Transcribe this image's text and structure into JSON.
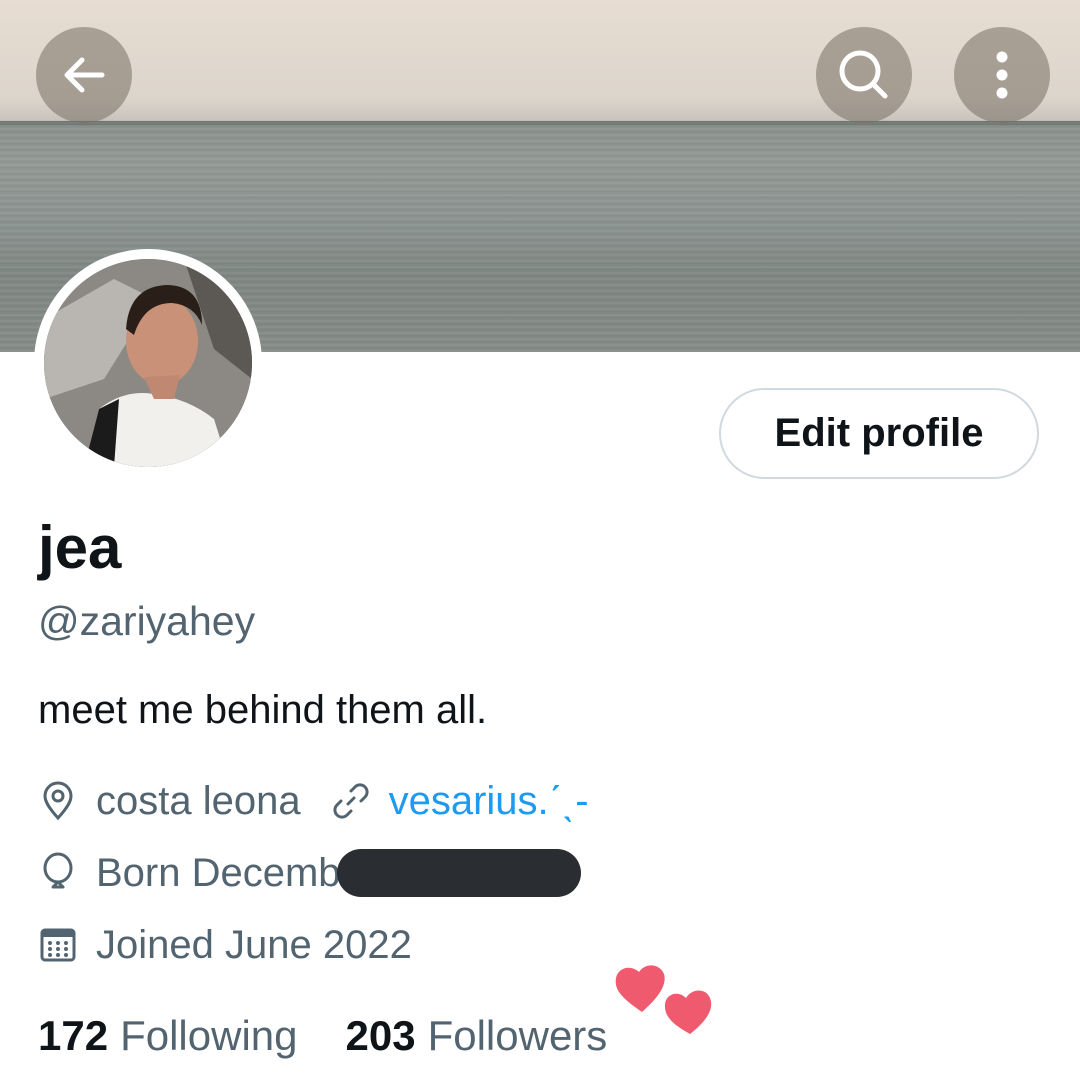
{
  "header": {
    "back_icon": "arrow-left-icon",
    "search_icon": "search-icon",
    "more_icon": "more-vertical-icon"
  },
  "profile": {
    "name": "jea",
    "handle": "@zariyahey",
    "bio": "meet me behind them all.",
    "location": "costa leona",
    "website": "vesarius.ˊˎ-",
    "birthday": "Born Decemb",
    "joined": "Joined June 2022",
    "edit_label": "Edit profile"
  },
  "stats": {
    "following_count": "172",
    "following_label": "Following",
    "followers_count": "203",
    "followers_label": "Followers"
  },
  "colors": {
    "accent": "#1d9bf0",
    "muted": "#536471",
    "text": "#0f1419",
    "heart": "#ef5a6f"
  }
}
